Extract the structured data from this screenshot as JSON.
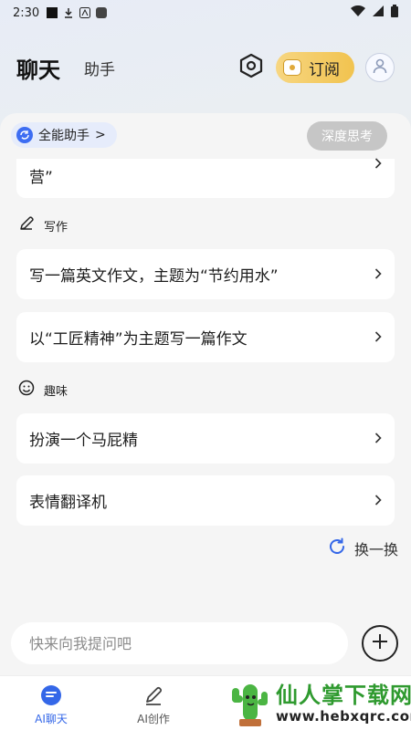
{
  "status_bar": {
    "time": "2:30"
  },
  "header": {
    "tab_chat": "聊天",
    "tab_assistant": "助手",
    "subscribe_label": "订阅"
  },
  "panel": {
    "assistant_chip": "全能助手",
    "assistant_chip_chevron": ">",
    "deep_think": "深度思考",
    "partial_item": "营”",
    "sections": [
      {
        "title": "写作",
        "icon": "pencil-icon",
        "items": [
          {
            "label": "写一篇英文作文，主题为“节约用水”"
          },
          {
            "label": "以“工匠精神”为主题写一篇作文"
          }
        ]
      },
      {
        "title": "趣味",
        "icon": "smiley-icon",
        "items": [
          {
            "label": "扮演一个马屁精"
          },
          {
            "label": "表情翻译机"
          }
        ]
      }
    ],
    "refresh_label": "换一换"
  },
  "input": {
    "placeholder": "快来向我提问吧"
  },
  "bottom_nav": {
    "items": [
      {
        "label": "AI聊天",
        "icon": "chat-icon",
        "active": true
      },
      {
        "label": "AI创作",
        "icon": "pen-icon",
        "active": false
      }
    ]
  },
  "watermark": {
    "title": "仙人掌下载网",
    "url": "www.hebxqrc.com"
  },
  "colors": {
    "accent": "#3467e8",
    "subscribe": "#f1c34f",
    "panel_bg": "#f5f5f5"
  }
}
